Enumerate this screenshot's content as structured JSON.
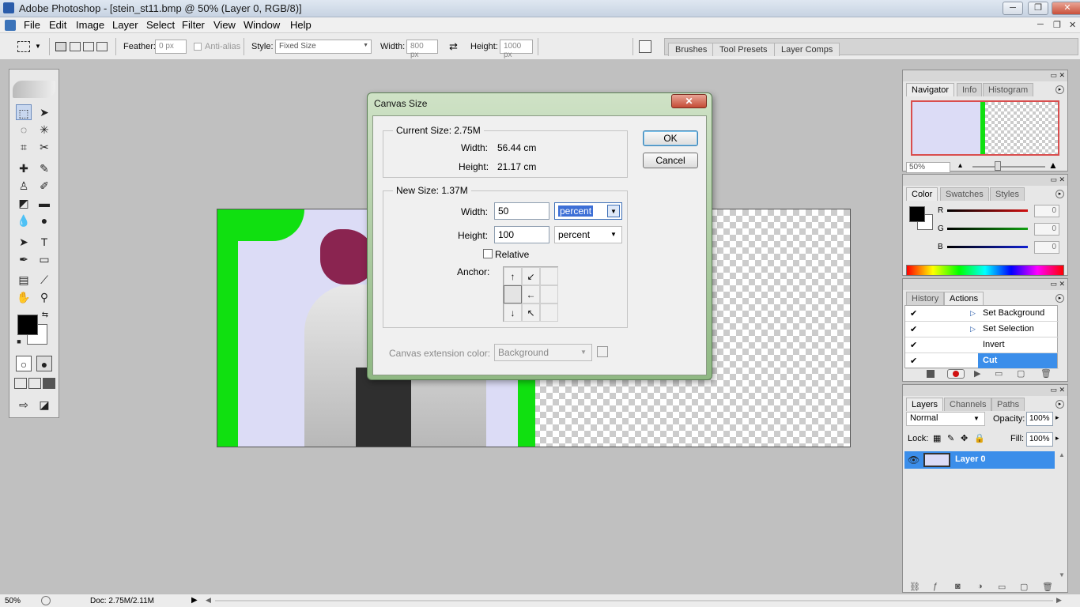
{
  "window": {
    "title": "Adobe Photoshop - [stein_st11.bmp @ 50% (Layer 0, RGB/8)]",
    "minimize_label": "─",
    "maximize_label": "❐",
    "close_label": "✕"
  },
  "menubar": {
    "items": [
      "File",
      "Edit",
      "Image",
      "Layer",
      "Select",
      "Filter",
      "View",
      "Window",
      "Help"
    ],
    "doc_minimize": "─",
    "doc_restore": "❐",
    "doc_close": "✕"
  },
  "options": {
    "feather_label": "Feather:",
    "feather_value": "0 px",
    "antialias_label": "Anti-alias",
    "style_label": "Style:",
    "style_value": "Fixed Size",
    "width_label": "Width:",
    "width_value": "800 px",
    "height_label": "Height:",
    "height_value": "1000 px",
    "palette_tabs": [
      "Brushes",
      "Tool Presets",
      "Layer Comps"
    ]
  },
  "dialog": {
    "title": "Canvas Size",
    "close_label": "✕",
    "current_size_legend": "Current Size: 2.75M",
    "current_width_label": "Width:",
    "current_width_value": "56.44 cm",
    "current_height_label": "Height:",
    "current_height_value": "21.17 cm",
    "new_size_legend": "New Size: 1.37M",
    "width_label": "Width:",
    "width_value": "50",
    "width_unit": "percent",
    "height_label": "Height:",
    "height_value": "100",
    "height_unit": "percent",
    "relative_label": "Relative",
    "relative_checked": false,
    "anchor_label": "Anchor:",
    "extension_label": "Canvas extension color:",
    "extension_value": "Background",
    "ok_label": "OK",
    "cancel_label": "Cancel"
  },
  "navigator": {
    "tabs": [
      "Navigator",
      "Info",
      "Histogram"
    ],
    "zoom": "50%"
  },
  "color_panel": {
    "tabs": [
      "Color",
      "Swatches",
      "Styles"
    ],
    "channels": [
      {
        "label": "R",
        "value": "0",
        "color": "#d01010"
      },
      {
        "label": "G",
        "value": "0",
        "color": "#10a010"
      },
      {
        "label": "B",
        "value": "0",
        "color": "#1020d0"
      }
    ]
  },
  "actions_panel": {
    "tabs": [
      "History",
      "Actions"
    ],
    "rows": [
      {
        "name": "Set Background",
        "checked": true,
        "expandable": true,
        "selected": false
      },
      {
        "name": "Set Selection",
        "checked": true,
        "expandable": true,
        "selected": false
      },
      {
        "name": "Invert",
        "checked": true,
        "expandable": false,
        "selected": false
      },
      {
        "name": "Cut",
        "checked": true,
        "expandable": false,
        "selected": true
      }
    ]
  },
  "layers_panel": {
    "tabs": [
      "Layers",
      "Channels",
      "Paths"
    ],
    "blend_mode": "Normal",
    "opacity_label": "Opacity:",
    "opacity_value": "100%",
    "lock_label": "Lock:",
    "fill_label": "Fill:",
    "fill_value": "100%",
    "layer_name": "Layer 0"
  },
  "status": {
    "zoom": "50%",
    "doc_info": "Doc: 2.75M/2.11M"
  },
  "colors": {
    "accent": "#3b8eea",
    "dialog_frame": "#8fb883",
    "canvas_green": "#10e010"
  }
}
